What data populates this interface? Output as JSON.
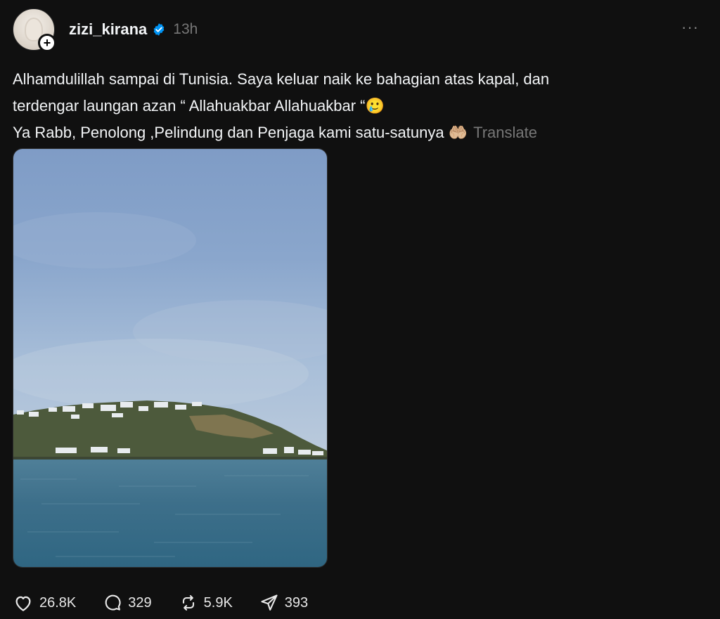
{
  "post": {
    "username": "zizi_kirana",
    "timestamp": "13h",
    "more_label": "···",
    "text_lines": [
      "Alhamdulillah sampai di Tunisia. Saya keluar naik ke bahagian atas kapal, dan",
      "terdengar laungan azan “ Allahuakbar Allahuakbar “🥲",
      "Ya Rabb, Penolong ,Pelindung dan Penjaga kami satu-satunya 🤲🏼"
    ],
    "translate_label": "Translate",
    "follow_symbol": "+"
  },
  "actions": {
    "likes": "26.8K",
    "replies": "329",
    "reposts": "5.9K",
    "shares": "393"
  },
  "icons": {
    "verified": "verified-badge-icon",
    "more": "more-options-icon",
    "like": "heart-icon",
    "reply": "comment-icon",
    "repost": "repost-icon",
    "share": "send-icon"
  },
  "colors": {
    "background": "#101010",
    "text": "#f3f5f7",
    "muted": "#777777",
    "verified": "#0095f6"
  }
}
